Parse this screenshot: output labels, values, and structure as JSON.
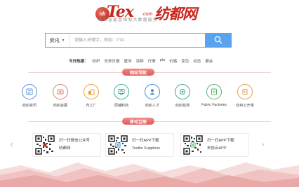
{
  "logo": {
    "ball_text": "nb",
    "brand_latin": "Tex",
    "brand_domain": ".com",
    "brand_cn": "纺都网"
  },
  "slogan": "纺织智能营销和大数据服务",
  "search": {
    "category": "资讯",
    "placeholder": "请输入关键字，例如：PTA"
  },
  "hot": {
    "label": "今日热搜：",
    "items": [
      "纺织",
      "仓单日报",
      "盛泽",
      "涤棉",
      "行情",
      "pta",
      "价格",
      "变色",
      "动态",
      "展会"
    ]
  },
  "sections": {
    "nav_title": "网站导航",
    "mobile_title": "移动互联"
  },
  "nav": [
    {
      "label": "纺织资讯",
      "icon": "news-icon",
      "color": "#5b8fd9"
    },
    {
      "label": "纺织会展",
      "icon": "exhibition-icon",
      "color": "#e07a6a"
    },
    {
      "label": "布工厂",
      "icon": "factory-icon",
      "color": "#e8a23b"
    },
    {
      "label": "原辅料商",
      "icon": "materials-icon",
      "color": "#3aa89a"
    },
    {
      "label": "纺织人才",
      "icon": "talent-icon",
      "color": "#3c8fd6"
    },
    {
      "label": "纺织检测",
      "icon": "inspection-icon",
      "color": "#3aa89a"
    },
    {
      "label": "Fabric Factories",
      "icon": "fabric-icon",
      "color": "#58b36a"
    },
    {
      "label": "纺织公开课",
      "icon": "course-icon",
      "color": "#e0a04a"
    }
  ],
  "cards": [
    {
      "line1": "扫一扫微信公众号",
      "line2": "纺都网"
    },
    {
      "line1": "扫一扫APP下载",
      "line2": "Textile Suppliers"
    },
    {
      "line1": "扫一扫APP下载",
      "line2": "布协云APP"
    }
  ],
  "arrows": {
    "left": "‹",
    "right": "›"
  }
}
